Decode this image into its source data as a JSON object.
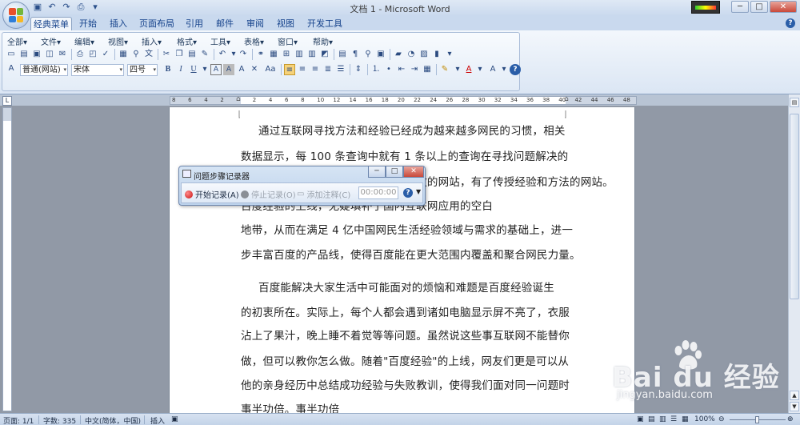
{
  "window": {
    "title": "文档 1 - Microsoft Word"
  },
  "ribbon_tabs": [
    "经典菜单",
    "开始",
    "插入",
    "页面布局",
    "引用",
    "邮件",
    "审阅",
    "视图",
    "开发工具"
  ],
  "classic_menu": [
    "全部▾",
    "文件▾",
    "编辑▾",
    "视图▾",
    "插入▾",
    "格式▾",
    "工具▾",
    "表格▾",
    "窗口▾",
    "帮助▾"
  ],
  "format_bar": {
    "style": "普通(网站)",
    "font": "宋体",
    "size": "四号",
    "bold": "B",
    "italic": "I",
    "underline": "U",
    "font_color_label": "A",
    "case_label": "Aa"
  },
  "ruler": {
    "ticks": [
      "8",
      "6",
      "4",
      "2",
      "",
      "2",
      "4",
      "6",
      "8",
      "10",
      "12",
      "14",
      "16",
      "18",
      "20",
      "22",
      "24",
      "26",
      "28",
      "30",
      "32",
      "34",
      "36",
      "38",
      "40",
      "42",
      "44",
      "46",
      "48"
    ]
  },
  "document": {
    "lines": [
      "通过互联网寻找方法和经验已经成为越来越多网民的习惯，相关",
      "数据显示，每 100 条查询中就有 1 条以上的查询在寻找问题解决的",
      "方法，但国内还没有一个专门的、有效的网站，有了传授经验和方法的网站。",
      "百度经验的上线，无疑填补了国内互联网应用的空白",
      "地带，从而在满足 4 亿中国网民生活经验领域与需求的基础上，进一",
      "步丰富百度的产品线，使得百度能在更大范围内覆盖和聚合网民力量。",
      "百度能解决大家生活中可能面对的烦恼和难题是百度经验诞生",
      "的初衷所在。实际上，每个人都会遇到诸如电脑显示屏不亮了，衣服",
      "沾上了果汁，晚上睡不着觉等等问题。虽然说这些事互联网不能替你",
      "做，但可以教你怎么做。随着\"百度经验\"的上线，网友们更是可以从",
      "他的亲身经历中总结成功经验与失败教训，使得我们面对同一问题时",
      "事半功倍。事半功倍"
    ]
  },
  "dialog": {
    "title": "问题步骤记录器",
    "start": "开始记录(A)",
    "stop": "停止记录(O)",
    "comment": "添加注释(C)",
    "timer": "00:00:00",
    "help": "?"
  },
  "statusbar": {
    "page": "页面: 1/1",
    "words": "字数: 335",
    "language": "中文(简体，中国)",
    "mode": "插入",
    "zoom": "100%"
  },
  "watermark": {
    "text": "Bai du 经验",
    "sub": "jingyan.baidu.com"
  }
}
